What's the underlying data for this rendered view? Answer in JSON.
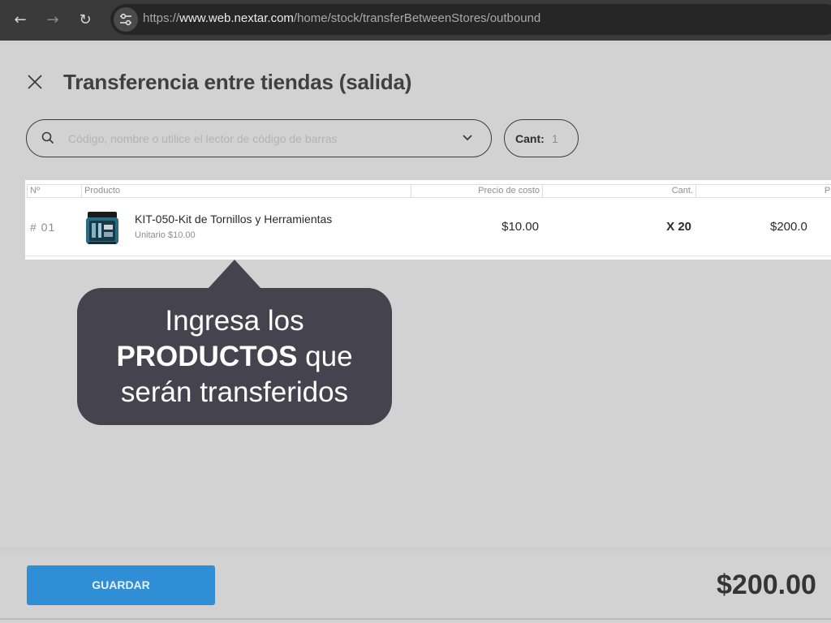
{
  "browser": {
    "url_prefix": "https://",
    "url_domain": "www.web.nextar.com",
    "url_path": "/home/stock/transferBetweenStores/outbound"
  },
  "page": {
    "title": "Transferencia entre tiendas (salida)"
  },
  "search": {
    "placeholder": "Código, nombre o utilice el lector de código de barras"
  },
  "quantity": {
    "label": "Cant:",
    "value": "1"
  },
  "table": {
    "headers": {
      "num": "Nº",
      "product": "Producto",
      "cost": "Precio de costo",
      "qty": "Cant.",
      "total": "Pre"
    },
    "rows": [
      {
        "num": "# 01",
        "name": "KIT-050-Kit de Tornillos y Herramientas",
        "unit": "Unitario $10.00",
        "cost": "$10.00",
        "qty": "X 20",
        "total": "$200.0"
      }
    ]
  },
  "tooltip": {
    "line1": "Ingresa los",
    "bold": "PRODUCTOS",
    "after_bold": " que",
    "line3": "serán transferidos"
  },
  "footer": {
    "save_label": "GUARDAR",
    "grand_total": "$200.00"
  },
  "colors": {
    "accent": "#2f8ed6",
    "tooltip": "#45444e",
    "overlay": "#d3d2d3"
  }
}
